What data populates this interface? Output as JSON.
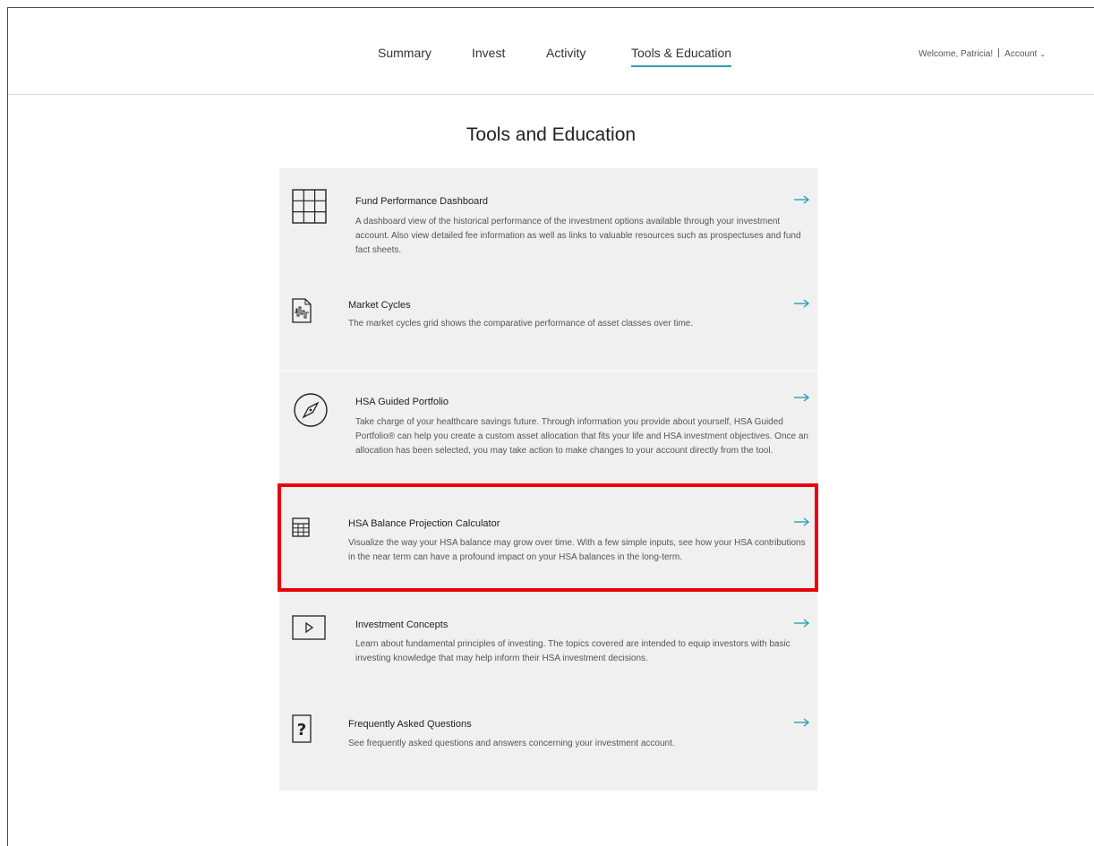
{
  "nav": {
    "tabs": [
      {
        "label": "Summary"
      },
      {
        "label": "Invest"
      },
      {
        "label": "Activity"
      },
      {
        "label": "Tools & Education",
        "active": true
      }
    ],
    "welcome": "Welcome, Patricia!",
    "account_label": "Account",
    "account_chevron": "⌄"
  },
  "page": {
    "title": "Tools and Education"
  },
  "cards": [
    {
      "icon": "grid-table-icon",
      "title": "Fund Performance Dashboard",
      "desc": "A dashboard view of the historical performance of the investment options available through your investment account. Also view detailed fee information as well as links to valuable resources such as prospectuses and fund fact sheets."
    },
    {
      "icon": "market-chart-icon",
      "title": "Market Cycles",
      "desc": "The market cycles grid shows the comparative performance of asset classes over time."
    },
    {
      "icon": "compass-icon",
      "title": "HSA Guided Portfolio",
      "desc": "Take charge of your healthcare savings future. Through information you provide about yourself, HSA Guided Portfolio® can help you create a custom asset allocation that fits your life and HSA investment objectives. Once an allocation has been selected, you may take action to make changes to your account directly from the tool."
    },
    {
      "icon": "calculator-icon",
      "title": "HSA Balance Projection Calculator",
      "desc": "Visualize the way your HSA balance may grow over time. With a few simple inputs, see how your HSA contributions in the near term can have a profound impact on your HSA balances in the long-term."
    },
    {
      "icon": "play-icon",
      "title": "Investment Concepts",
      "desc": "Learn about fundamental principles of investing. The topics covered are intended to equip investors with basic investing knowledge that may help inform their HSA investment decisions."
    },
    {
      "icon": "question-icon",
      "title": "Frequently Asked Questions",
      "desc": "See frequently asked questions and answers concerning your investment account."
    }
  ],
  "colors": {
    "accent": "#2d9fb5",
    "highlight": "#e8000b",
    "panel": "#f0f0f0"
  }
}
